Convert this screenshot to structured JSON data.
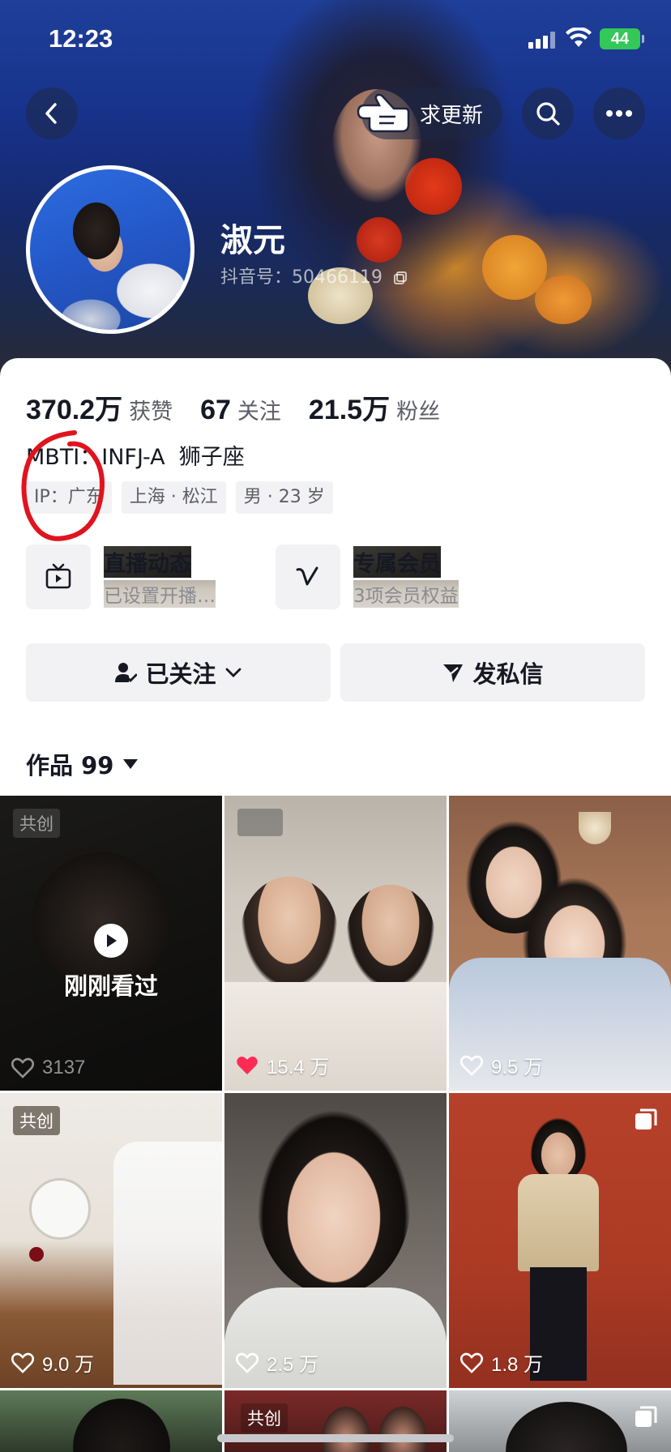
{
  "status_bar": {
    "time": "12:23",
    "battery": "44"
  },
  "header": {
    "update_button": "求更新"
  },
  "profile": {
    "name": "淑元",
    "douyin_id": "抖音号：50466119",
    "stats": [
      {
        "value": "370.2万",
        "label": "获赞"
      },
      {
        "value": "67",
        "label": "关注"
      },
      {
        "value": "21.5万",
        "label": "粉丝"
      }
    ],
    "bio": "MBTI：INFJ-A  狮子座",
    "tags": [
      "IP：广东",
      "上海 · 松江",
      "男 · 23 岁"
    ]
  },
  "features": [
    {
      "title": "直播动态",
      "subtitle": "已设置开播…",
      "icon": "tv-icon"
    },
    {
      "title": "专属会员",
      "subtitle": "3项会员权益",
      "icon": "v-icon"
    }
  ],
  "actions": {
    "follow": "已关注",
    "message": "发私信"
  },
  "works": {
    "label": "作品 99"
  },
  "tiles": [
    {
      "badge": "共创",
      "likes": "3137",
      "overlay": "刚刚看过",
      "liked": false
    },
    {
      "badge": "",
      "likes": "15.4 万",
      "liked": true
    },
    {
      "likes": "9.5 万",
      "liked": false
    },
    {
      "badge": "共创",
      "likes": "9.0 万",
      "liked": false
    },
    {
      "likes": "2.5 万",
      "liked": false
    },
    {
      "likes": "1.8 万",
      "liked": false,
      "multi": true
    },
    {
      "likes": ""
    },
    {
      "badge": "共创"
    },
    {
      "multi": true
    }
  ],
  "colors": {
    "liked": "#fe2c55",
    "annotation": "#e0141e"
  }
}
